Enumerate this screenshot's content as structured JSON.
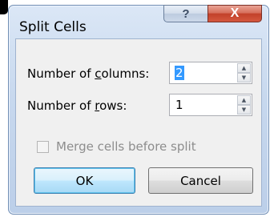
{
  "dialog": {
    "title": "Split Cells",
    "help_glyph": "?",
    "close_glyph": "X"
  },
  "fields": {
    "columns": {
      "label_pre": "Number of ",
      "label_key": "c",
      "label_post": "olumns:",
      "value": "2",
      "up_arrow": "▲",
      "down_arrow": "▼"
    },
    "rows": {
      "label_pre": "Number of ",
      "label_key": "r",
      "label_post": "ows:",
      "value": "1",
      "up_arrow": "▲",
      "down_arrow": "▼"
    }
  },
  "merge": {
    "label": "Merge cells before split",
    "checked": false,
    "enabled": false
  },
  "buttons": {
    "ok": "OK",
    "cancel": "Cancel"
  },
  "colors": {
    "title_gradient_top": "#dbe7f6",
    "close_button": "#c2412a",
    "selection": "#3399ff",
    "disabled_text": "#8d8d8d"
  },
  "icons": {
    "help": "help-icon",
    "close": "close-icon",
    "spin_up": "chevron-up-icon",
    "spin_down": "chevron-down-icon"
  }
}
